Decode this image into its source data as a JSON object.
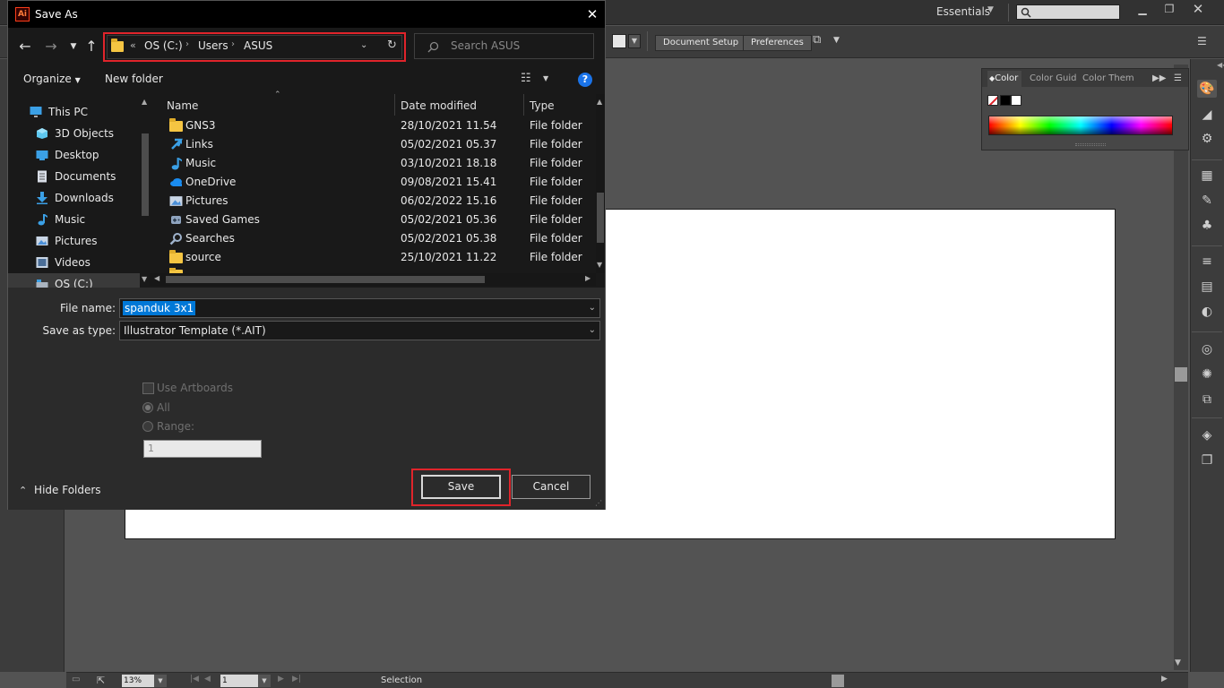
{
  "illustrator": {
    "workspace": "Essentials",
    "control_bar": {
      "document_setup": "Document Setup",
      "preferences": "Preferences"
    },
    "color_panel": {
      "tabs": [
        "Color",
        "Color Guidé",
        "Color Them"
      ],
      "tab_color": "Color",
      "tab_guide": "Color Guid",
      "tab_theme": "Color Them"
    },
    "status_bar": {
      "zoom": "13%",
      "artboard_number": "1",
      "mode": "Selection"
    }
  },
  "dialog": {
    "title": "Save As",
    "app_icon_text": "Ai",
    "address": {
      "overflow": "«",
      "crumbs": [
        "OS (C:)",
        "Users",
        "ASUS"
      ],
      "crumb_1": "OS (C:)",
      "crumb_2": "Users",
      "crumb_3": "ASUS"
    },
    "search_placeholder": "Search ASUS",
    "commands": {
      "organize": "Organize",
      "new_folder": "New folder"
    },
    "nav_tree": [
      {
        "label": "This PC",
        "icon": "pc-icon"
      },
      {
        "label": "3D Objects",
        "icon": "cube-icon"
      },
      {
        "label": "Desktop",
        "icon": "desktop-icon"
      },
      {
        "label": "Documents",
        "icon": "documents-icon"
      },
      {
        "label": "Downloads",
        "icon": "downloads-icon"
      },
      {
        "label": "Music",
        "icon": "music-icon"
      },
      {
        "label": "Pictures",
        "icon": "pictures-icon"
      },
      {
        "label": "Videos",
        "icon": "videos-icon"
      },
      {
        "label": "OS (C:)",
        "icon": "drive-icon"
      }
    ],
    "columns": {
      "name": "Name",
      "date": "Date modified",
      "type": "Type"
    },
    "files": [
      {
        "name": "GNS3",
        "date": "28/10/2021 11.54",
        "type": "File folder",
        "icon": "folder-icon"
      },
      {
        "name": "Links",
        "date": "05/02/2021 05.37",
        "type": "File folder",
        "icon": "links-icon"
      },
      {
        "name": "Music",
        "date": "03/10/2021 18.18",
        "type": "File folder",
        "icon": "music-icon"
      },
      {
        "name": "OneDrive",
        "date": "09/08/2021 15.41",
        "type": "File folder",
        "icon": "cloud-icon"
      },
      {
        "name": "Pictures",
        "date": "06/02/2022 15.16",
        "type": "File folder",
        "icon": "pictures-icon"
      },
      {
        "name": "Saved Games",
        "date": "05/02/2021 05.36",
        "type": "File folder",
        "icon": "games-icon"
      },
      {
        "name": "Searches",
        "date": "05/02/2021 05.38",
        "type": "File folder",
        "icon": "search-icon"
      },
      {
        "name": "source",
        "date": "25/10/2021 11.22",
        "type": "File folder",
        "icon": "folder-icon"
      }
    ],
    "file_name": {
      "label": "File name:",
      "value": "spanduk 3x1"
    },
    "save_type": {
      "label": "Save as type:",
      "value": "Illustrator Template (*.AIT)"
    },
    "options": {
      "use_artboards": "Use Artboards",
      "all": "All",
      "range": "Range:",
      "range_value": "1"
    },
    "hide_folders": "Hide Folders",
    "save": "Save",
    "cancel": "Cancel"
  },
  "colors": {
    "highlight_red": "#e0242b",
    "selection_blue": "#0078d7",
    "dialog_bg": "#191919",
    "ai_bg": "#535353"
  }
}
